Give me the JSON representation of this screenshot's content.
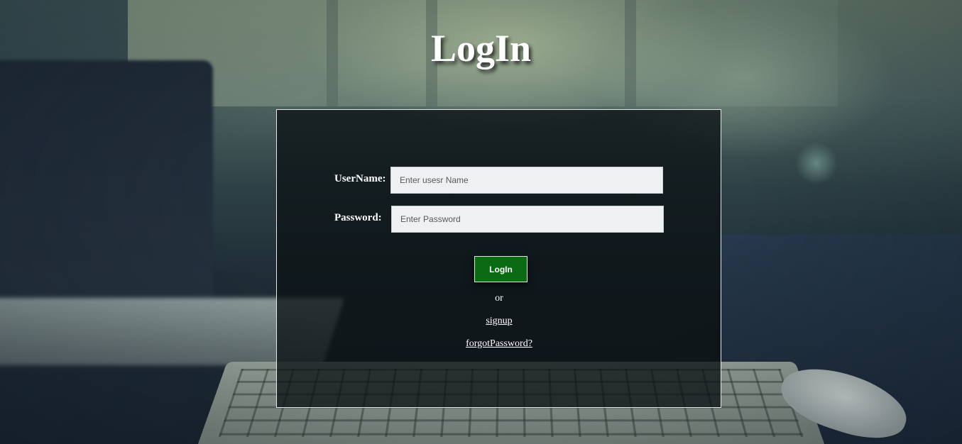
{
  "header": {
    "title": "LogIn"
  },
  "form": {
    "username": {
      "label": "UserName:",
      "placeholder": "Enter usesr Name",
      "value": ""
    },
    "password": {
      "label": "Password:",
      "placeholder": "Enter Password",
      "value": ""
    },
    "login_button_label": "LogIn",
    "separator_text": "or",
    "signup_link": "signup",
    "forgot_password_link": "forgotPassword?"
  },
  "colors": {
    "login_button": "#0a6b12",
    "text": "#ffffff",
    "input_background": "#eef0f2"
  }
}
